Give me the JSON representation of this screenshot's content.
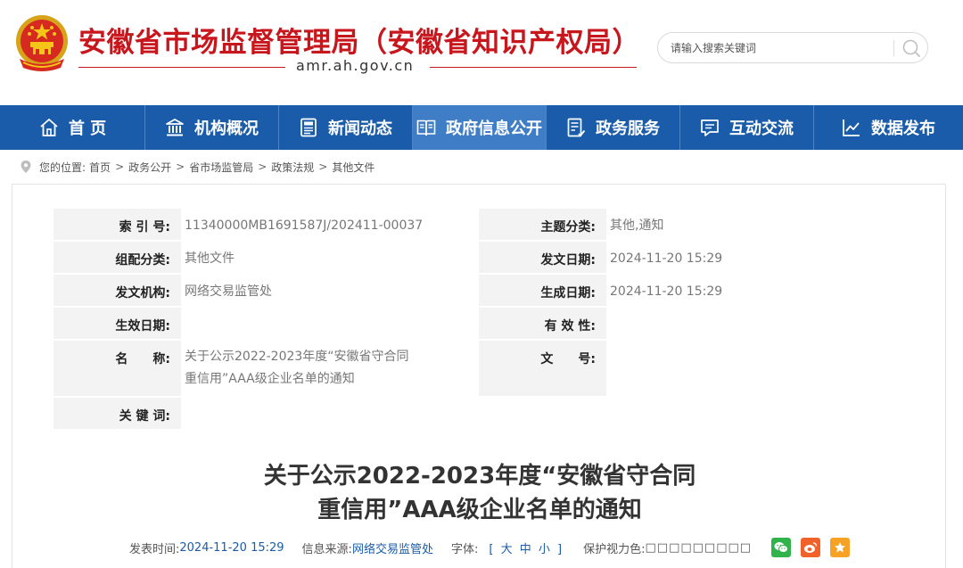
{
  "header": {
    "site_title": "安徽省市场监督管理局（安徽省知识产权局）",
    "site_domain": "amr.ah.gov.cn",
    "search_placeholder": "请输入搜索关键词",
    "emblem_icon": "national-emblem-icon",
    "search_icon": "search-icon",
    "brand_color": "#c8161d"
  },
  "nav": {
    "color": "#1a5ca9",
    "active_color": "#3f7ec7",
    "items": [
      {
        "label": "首 页",
        "icon": "home-icon"
      },
      {
        "label": "机构概况",
        "icon": "building-icon"
      },
      {
        "label": "新闻动态",
        "icon": "news-icon"
      },
      {
        "label": "政府信息公开",
        "icon": "open-book-icon",
        "active": true
      },
      {
        "label": "政务服务",
        "icon": "service-form-icon"
      },
      {
        "label": "互动交流",
        "icon": "chat-icon"
      },
      {
        "label": "数据发布",
        "icon": "line-chart-icon"
      }
    ]
  },
  "breadcrumb": {
    "prefix": "您的位置:",
    "items": [
      "首页",
      "政务公开",
      "省市场监管局",
      "政策法规",
      "其他文件"
    ],
    "separator": ">"
  },
  "meta": {
    "index_no_label": "索 引 号:",
    "index_no": "11340000MB1691587J/202411-00037",
    "topic_label": "主题分类:",
    "topic": "其他,通知",
    "org_class_label": "组配分类:",
    "org_class": "其他文件",
    "issue_date_label": "发文日期:",
    "issue_date": "2024-11-20 15:29",
    "issuer_label": "发文机构:",
    "issuer": "网络交易监管处",
    "created_date_label": "生成日期:",
    "created_date": "2024-11-20 15:29",
    "effective_label": "生效日期:",
    "effective": "",
    "validity_label": "有 效 性:",
    "validity": "",
    "name_label": "名　　称:",
    "name_line1": "关于公示2022-2023年度“安徽省守合同",
    "name_line2": "重信用”AAA级企业名单的通知",
    "doc_no_label": "文　　号:",
    "doc_no": "",
    "keywords_label": "关 键 词:",
    "keywords": ""
  },
  "article": {
    "title_line1": "关于公示2022-2023年度“安徽省守合同",
    "title_line2": "重信用”AAA级企业名单的通知"
  },
  "info_bar": {
    "publish_label": "发表时间:",
    "publish_time": "2024-11-20 15:29",
    "source_label": "信息来源:",
    "source": "网络交易监管处",
    "font_label": "字体:",
    "font_open": "[",
    "font_large": "大",
    "font_medium": "中",
    "font_small": "小",
    "font_close": "]",
    "eye_label": "保护视力色:",
    "eye_colors": "□□□□□□□□□",
    "share_icons": [
      "wechat-icon",
      "weibo-icon",
      "favorite-star-icon"
    ]
  }
}
